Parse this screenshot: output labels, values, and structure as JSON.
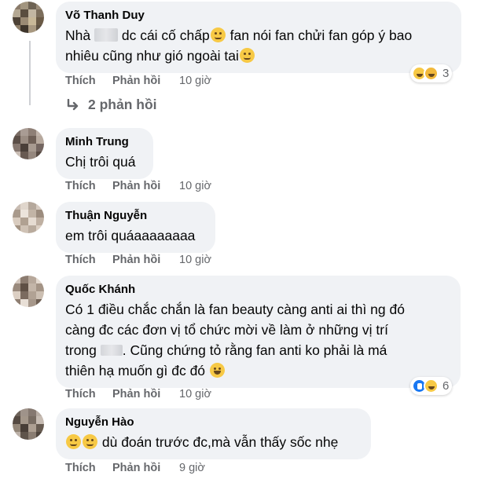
{
  "comments": [
    {
      "author": "Võ Thanh Duy",
      "text_parts": [
        "Nhà",
        "dc cái cố chấp",
        "fan nói fan chửi fan góp ý bao",
        "nhiêu cũng như gió ngoài tai"
      ],
      "like_label": "Thích",
      "reply_label": "Phản hồi",
      "time": "10 giờ",
      "reaction_count": "3",
      "reaction_icons": [
        "haha-icon",
        "sad-icon"
      ],
      "replies_label": "2 phản hồi"
    },
    {
      "author": "Minh Trung",
      "text": "Chị trôi quá",
      "like_label": "Thích",
      "reply_label": "Phản hồi",
      "time": "10 giờ"
    },
    {
      "author": "Thuận Nguyễn",
      "text": "em trôi quáaaaaaaaa",
      "like_label": "Thích",
      "reply_label": "Phản hồi",
      "time": "10 giờ"
    },
    {
      "author": "Quốc Khánh",
      "text_lines": [
        "Có 1 điều chắc chắn là fan beauty càng anti ai thì ng đó",
        "càng đc các đơn vị tổ chức mời về làm ở những vị trí",
        "trong",
        ". Cũng chứng tỏ rằng fan anti ko phải là má",
        "thiên hạ muốn gì đc đó"
      ],
      "like_label": "Thích",
      "reply_label": "Phản hồi",
      "time": "10 giờ",
      "reaction_count": "6",
      "reaction_icons": [
        "like-icon",
        "haha-icon"
      ]
    },
    {
      "author": "Nguyễn Hào",
      "text": "dù đoán trước đc,mà vẫn thấy sốc nhẹ",
      "like_label": "Thích",
      "reply_label": "Phản hồi",
      "time": "9 giờ"
    }
  ],
  "colors": {
    "bubble": "#f0f2f5",
    "meta_text": "#65676b",
    "primary_text": "#050505",
    "like_blue": "#1877f2",
    "emoji_yellow": "#f7c945"
  }
}
